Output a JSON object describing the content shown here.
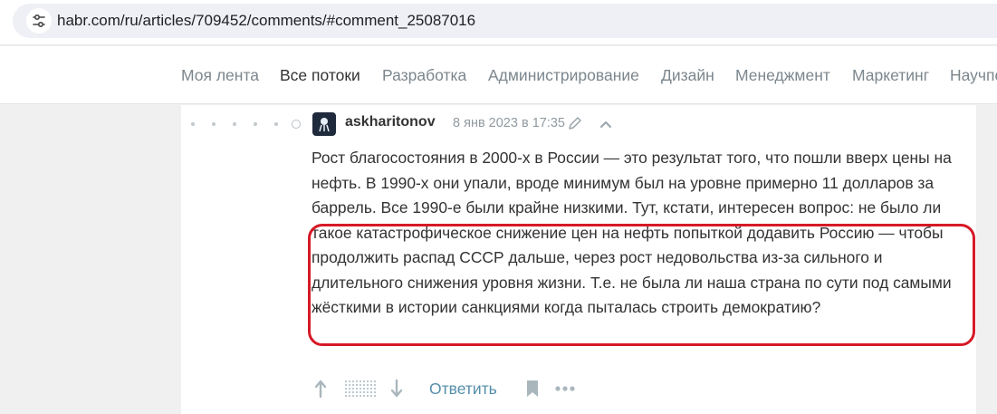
{
  "browser": {
    "url": "habr.com/ru/articles/709452/comments/#comment_25087016",
    "site_info_icon": "tune-icon"
  },
  "nav": {
    "items": [
      {
        "label": "Моя лента",
        "active": false
      },
      {
        "label": "Все потоки",
        "active": true
      },
      {
        "label": "Разработка",
        "active": false
      },
      {
        "label": "Администрирование",
        "active": false
      },
      {
        "label": "Дизайн",
        "active": false
      },
      {
        "label": "Менеджмент",
        "active": false
      },
      {
        "label": "Маркетинг",
        "active": false
      },
      {
        "label": "Научпо",
        "active": false
      }
    ]
  },
  "comment": {
    "username": "askharitonov",
    "timestamp": "8 янв 2023 в 17:35",
    "text": "Рост благосостояния в 2000-х в России — это результат того, что пошли вверх цены на нефть. В 1990-х они упали, вроде минимум был на уровне примерно 11 долларов за баррель. Все 1990-е были крайне низкими. Тут, кстати, интересен вопрос: не было ли такое катастрофическое снижение цен на нефть попыткой додавить Россию — чтобы продолжить распад СССР дальше, через рост недовольства из-за сильного и длительного снижения уровня жизни. Т.е. не была ли наша страна по сути под самыми жёсткими в истории санкциями когда пыталась строить демократию?",
    "icons": {
      "edit": "pencil-icon",
      "parent": "chevron-up-icon",
      "upvote": "arrow-up-icon",
      "downvote": "arrow-down-icon",
      "bookmark": "bookmark-icon",
      "more": "more-dots-icon"
    },
    "reply_label": "Ответить"
  },
  "colors": {
    "highlight": "#d61a26",
    "link": "#548eaa",
    "nav_inactive": "#7c868d",
    "nav_active": "#333333"
  }
}
